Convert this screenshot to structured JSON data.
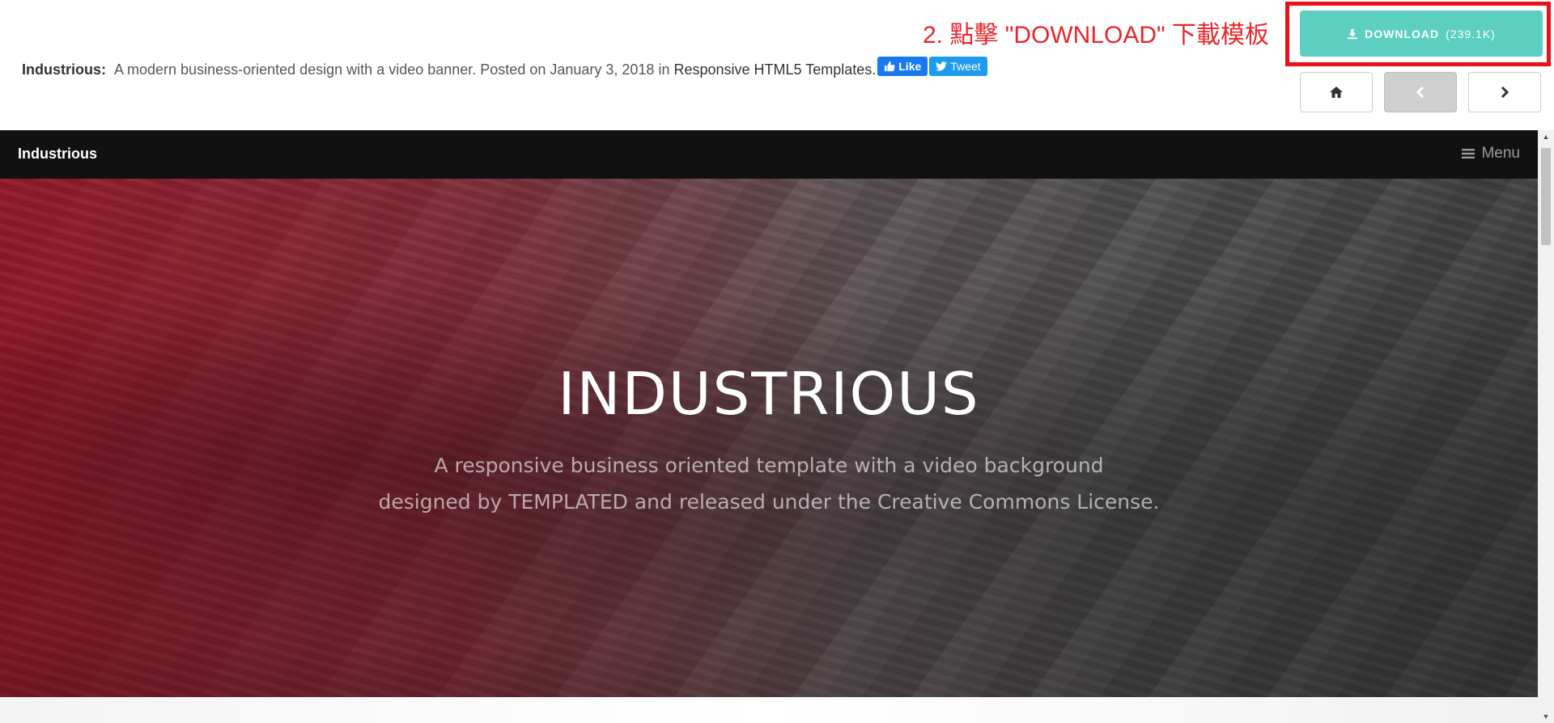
{
  "header": {
    "template_name": "Industrious:",
    "description": "A modern business-oriented design with a video banner. Posted on January 3, 2018 in",
    "category_link": "Responsive HTML5 Templates.",
    "like_label": "Like",
    "tweet_label": "Tweet",
    "annotation": "2. 點擊 \"DOWNLOAD\" 下載模板",
    "download_label": "DOWNLOAD",
    "download_size": "(239.1K)"
  },
  "nav_buttons": {
    "home_icon": "home-icon",
    "prev_icon": "chevron-left-icon",
    "next_icon": "chevron-right-icon"
  },
  "site": {
    "brand": "Industrious",
    "menu_label": "Menu",
    "hero_title": "INDUSTRIOUS",
    "hero_subtitle_line1": "A responsive business oriented template with a video background",
    "hero_subtitle_line2": "designed by TEMPLATED and released under the Creative Commons License."
  },
  "colors": {
    "download_button": "#5ccfc0",
    "annotation": "#e8262c",
    "highlight_frame": "#e8111a",
    "facebook": "#1877f2",
    "twitter": "#1d9bf0",
    "site_nav": "#111111"
  }
}
